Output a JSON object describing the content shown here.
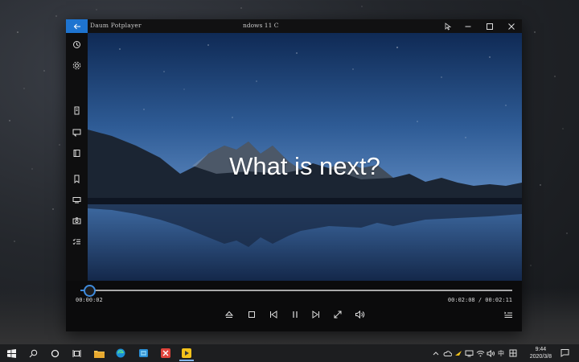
{
  "window": {
    "app_title": "Daum Potplayer",
    "media_title": "ndows 11 C"
  },
  "video": {
    "overlay_text": "What is next?"
  },
  "player": {
    "time_elapsed": "00:00:02",
    "time_total": "00:02:08 / 00:02:11",
    "progress_fraction": 0.02
  },
  "taskbar": {
    "ime_label": "中",
    "clock_time": "9:44",
    "clock_date": "2020/3/8"
  },
  "colors": {
    "accent": "#1e74d0",
    "seek": "#3f8bdc"
  }
}
